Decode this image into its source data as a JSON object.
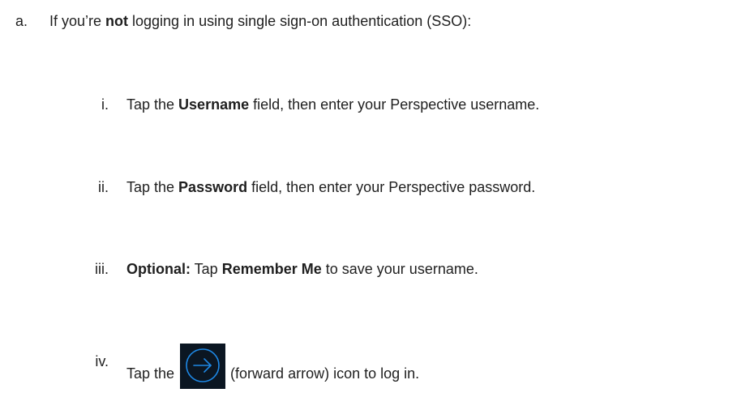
{
  "step_a": {
    "marker": "a.",
    "text_before": "If you’re ",
    "bold": "not",
    "text_after": " logging in using single sign-on authentication (SSO):"
  },
  "substeps": [
    {
      "marker": "i.",
      "text_before": "Tap the ",
      "bold": "Username",
      "text_after": " field, then enter your Perspective username."
    },
    {
      "marker": "ii.",
      "text_before": "Tap the ",
      "bold": "Password",
      "text_after": " field, then enter your Perspective password."
    },
    {
      "marker": "iii.",
      "bold_lead": "Optional:",
      "text_middle": " Tap ",
      "bold": "Remember Me",
      "text_after": " to save your username."
    },
    {
      "marker": "iv.",
      "text_before": "Tap the ",
      "icon_name": "forward-arrow-icon",
      "text_after": " (forward arrow) icon to log in."
    }
  ],
  "colors": {
    "icon_background": "#0b1622",
    "icon_stroke": "#1e88e5"
  }
}
